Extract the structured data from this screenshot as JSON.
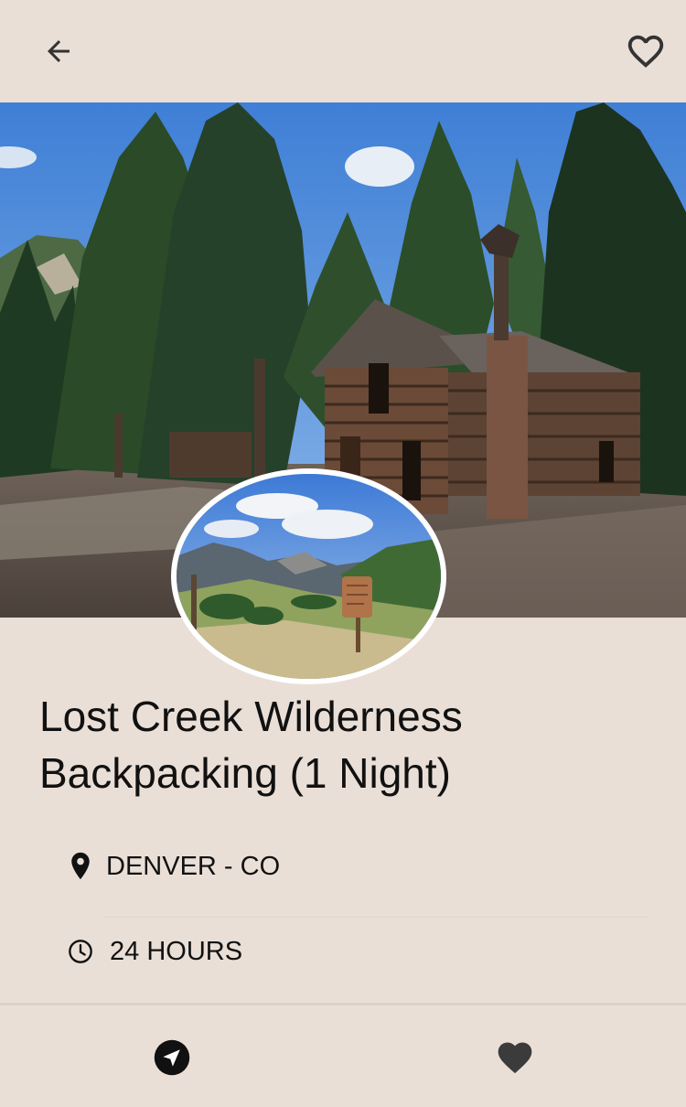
{
  "header": {
    "back_icon": "arrow-left-icon",
    "favorite_icon": "heart-outline-icon"
  },
  "hero": {
    "image": "log-cabin-in-pine-forest-photo"
  },
  "thumbnail": {
    "image": "mountain-valley-trail-sign-photo"
  },
  "trip": {
    "title": "Lost Creek Wilderness Backpacking (1 Night)",
    "location": "DENVER - CO",
    "location_icon": "map-pin-icon",
    "duration": "24 HOURS",
    "duration_icon": "clock-icon"
  },
  "bottom_nav": {
    "navigate_icon": "navigation-arrow-icon",
    "saved_icon": "heart-filled-icon"
  },
  "colors": {
    "background": "#eadfd7",
    "text": "#111111",
    "icon_dark": "#3b3b3b"
  }
}
